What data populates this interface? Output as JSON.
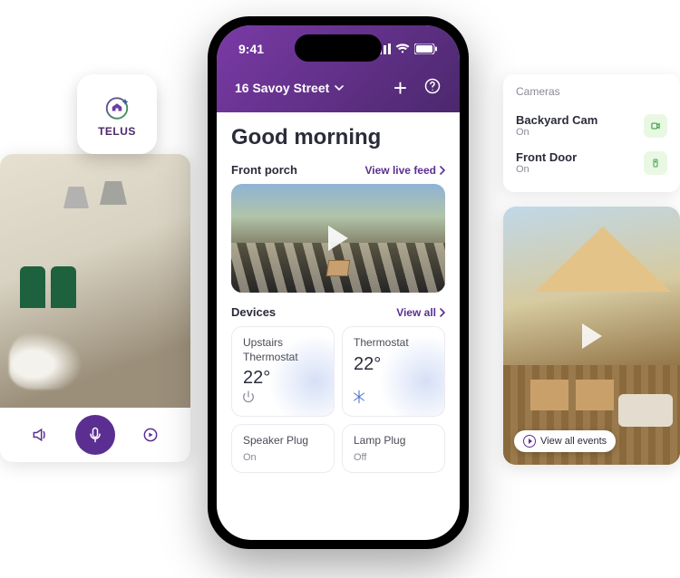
{
  "badge": {
    "label": "TELUS"
  },
  "status": {
    "time": "9:41"
  },
  "header": {
    "location": "16 Savoy Street",
    "add_icon": "plus",
    "help_icon": "question"
  },
  "greeting": "Good morning",
  "porch": {
    "title": "Front porch",
    "link": "View live feed"
  },
  "devices": {
    "title": "Devices",
    "link": "View all",
    "items": [
      {
        "name": "Upstairs Thermostat",
        "temp": "22°",
        "icon": "power"
      },
      {
        "name": "Thermostat",
        "temp": "22°",
        "icon": "snow"
      },
      {
        "name": "Speaker Plug",
        "state": "On"
      },
      {
        "name": "Lamp Plug",
        "state": "Off"
      }
    ]
  },
  "cameras": {
    "title": "Cameras",
    "items": [
      {
        "name": "Backyard Cam",
        "state": "On"
      },
      {
        "name": "Front Door",
        "state": "On"
      }
    ]
  },
  "right_feed": {
    "pill_label": "View all events"
  }
}
